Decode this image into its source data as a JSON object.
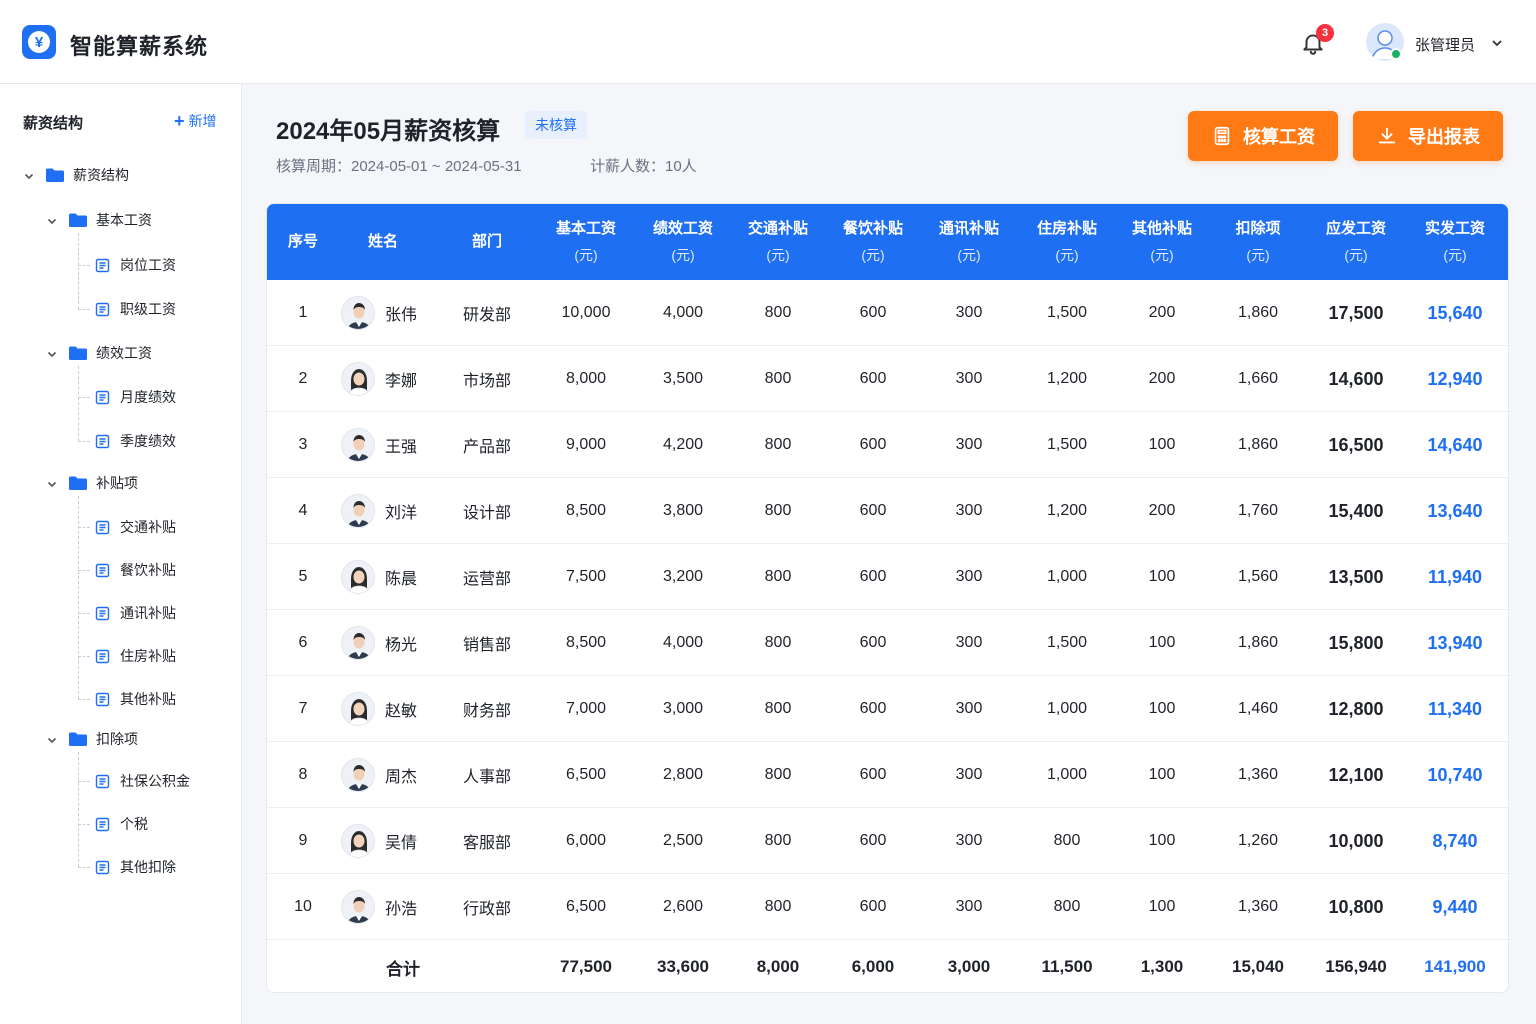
{
  "app": {
    "title": "智能算薪系统",
    "logo_symbol": "¥"
  },
  "header": {
    "notification_count": "3",
    "user_name": "张管理员"
  },
  "sidebar": {
    "title": "薪资结构",
    "add_label": "新增",
    "root": "薪资结构",
    "groups": [
      {
        "label": "基本工资",
        "items": [
          "岗位工资",
          "职级工资"
        ]
      },
      {
        "label": "绩效工资",
        "items": [
          "月度绩效",
          "季度绩效"
        ]
      },
      {
        "label": "补贴项",
        "items": [
          "交通补贴",
          "餐饮补贴",
          "通讯补贴",
          "住房补贴",
          "其他补贴"
        ]
      },
      {
        "label": "扣除项",
        "items": [
          "社保公积金",
          "个税",
          "其他扣除"
        ]
      }
    ]
  },
  "main": {
    "title": "2024年05月薪资核算",
    "status": "未核算",
    "period": "核算周期：2024-05-01 ~ 2024-05-31",
    "headcount": "计薪人数：10人",
    "buttons": {
      "calc": "核算工资",
      "export": "导出报表"
    }
  },
  "table": {
    "columns": [
      {
        "label": "序号",
        "unit": ""
      },
      {
        "label": "姓名",
        "unit": ""
      },
      {
        "label": "部门",
        "unit": ""
      },
      {
        "label": "基本工资",
        "unit": "(元)"
      },
      {
        "label": "绩效工资",
        "unit": "(元)"
      },
      {
        "label": "交通补贴",
        "unit": "(元)"
      },
      {
        "label": "餐饮补贴",
        "unit": "(元)"
      },
      {
        "label": "通讯补贴",
        "unit": "(元)"
      },
      {
        "label": "住房补贴",
        "unit": "(元)"
      },
      {
        "label": "其他补贴",
        "unit": "(元)"
      },
      {
        "label": "扣除项",
        "unit": "(元)"
      },
      {
        "label": "应发工资",
        "unit": "(元)"
      },
      {
        "label": "实发工资",
        "unit": "(元)"
      }
    ],
    "rows": [
      {
        "no": "1",
        "name": "张伟",
        "gender": "m",
        "dept": "研发部",
        "base": "10,000",
        "perf": "4,000",
        "traffic": "800",
        "meal": "600",
        "phone": "300",
        "housing": "1,500",
        "other": "200",
        "deduct": "1,860",
        "gross": "17,500",
        "net": "15,640"
      },
      {
        "no": "2",
        "name": "李娜",
        "gender": "f",
        "dept": "市场部",
        "base": "8,000",
        "perf": "3,500",
        "traffic": "800",
        "meal": "600",
        "phone": "300",
        "housing": "1,200",
        "other": "200",
        "deduct": "1,660",
        "gross": "14,600",
        "net": "12,940"
      },
      {
        "no": "3",
        "name": "王强",
        "gender": "m",
        "dept": "产品部",
        "base": "9,000",
        "perf": "4,200",
        "traffic": "800",
        "meal": "600",
        "phone": "300",
        "housing": "1,500",
        "other": "100",
        "deduct": "1,860",
        "gross": "16,500",
        "net": "14,640"
      },
      {
        "no": "4",
        "name": "刘洋",
        "gender": "m",
        "dept": "设计部",
        "base": "8,500",
        "perf": "3,800",
        "traffic": "800",
        "meal": "600",
        "phone": "300",
        "housing": "1,200",
        "other": "200",
        "deduct": "1,760",
        "gross": "15,400",
        "net": "13,640"
      },
      {
        "no": "5",
        "name": "陈晨",
        "gender": "f",
        "dept": "运营部",
        "base": "7,500",
        "perf": "3,200",
        "traffic": "800",
        "meal": "600",
        "phone": "300",
        "housing": "1,000",
        "other": "100",
        "deduct": "1,560",
        "gross": "13,500",
        "net": "11,940"
      },
      {
        "no": "6",
        "name": "杨光",
        "gender": "m",
        "dept": "销售部",
        "base": "8,500",
        "perf": "4,000",
        "traffic": "800",
        "meal": "600",
        "phone": "300",
        "housing": "1,500",
        "other": "100",
        "deduct": "1,860",
        "gross": "15,800",
        "net": "13,940"
      },
      {
        "no": "7",
        "name": "赵敏",
        "gender": "f",
        "dept": "财务部",
        "base": "7,000",
        "perf": "3,000",
        "traffic": "800",
        "meal": "600",
        "phone": "300",
        "housing": "1,000",
        "other": "100",
        "deduct": "1,460",
        "gross": "12,800",
        "net": "11,340"
      },
      {
        "no": "8",
        "name": "周杰",
        "gender": "m",
        "dept": "人事部",
        "base": "6,500",
        "perf": "2,800",
        "traffic": "800",
        "meal": "600",
        "phone": "300",
        "housing": "1,000",
        "other": "100",
        "deduct": "1,360",
        "gross": "12,100",
        "net": "10,740"
      },
      {
        "no": "9",
        "name": "吴倩",
        "gender": "f",
        "dept": "客服部",
        "base": "6,000",
        "perf": "2,500",
        "traffic": "800",
        "meal": "600",
        "phone": "300",
        "housing": "800",
        "other": "100",
        "deduct": "1,260",
        "gross": "10,000",
        "net": "8,740"
      },
      {
        "no": "10",
        "name": "孙浩",
        "gender": "m",
        "dept": "行政部",
        "base": "6,500",
        "perf": "2,600",
        "traffic": "800",
        "meal": "600",
        "phone": "300",
        "housing": "800",
        "other": "100",
        "deduct": "1,360",
        "gross": "10,800",
        "net": "9,440"
      }
    ],
    "totals": {
      "label": "合计",
      "base": "77,500",
      "perf": "33,600",
      "traffic": "8,000",
      "meal": "6,000",
      "phone": "3,000",
      "housing": "11,500",
      "other": "1,300",
      "deduct": "15,040",
      "gross": "156,940",
      "net": "141,900"
    }
  },
  "colors": {
    "primary": "#1e6ff2",
    "accent": "#ff7a14",
    "badge": "#f5313d"
  }
}
